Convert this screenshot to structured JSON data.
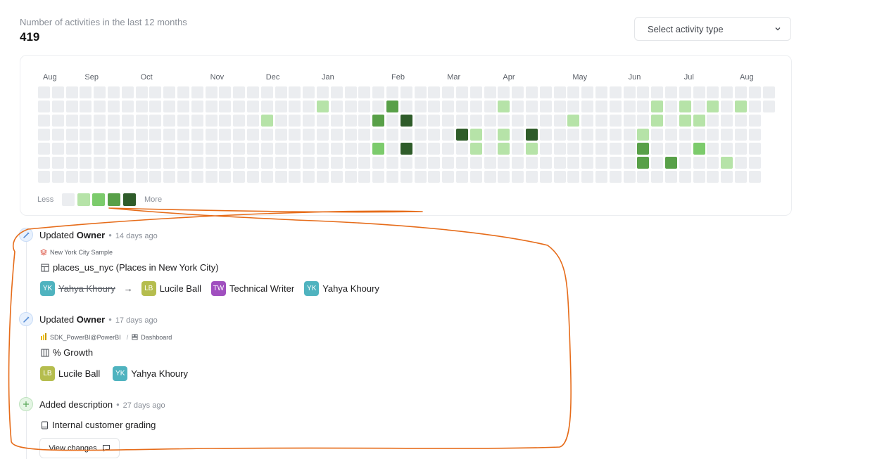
{
  "summary": {
    "label": "Number of activities in the last 12 months",
    "count": "419"
  },
  "filter": {
    "placeholder": "Select activity type"
  },
  "heatmap": {
    "months": [
      "Aug",
      "Sep",
      "Oct",
      "Nov",
      "Dec",
      "Jan",
      "Feb",
      "Mar",
      "Apr",
      "May",
      "Jun",
      "Jul",
      "Aug"
    ],
    "month_week_index": [
      0,
      3,
      7,
      12,
      16,
      20,
      25,
      29,
      33,
      38,
      42,
      46,
      50
    ],
    "weeks": 53,
    "days": 7,
    "last_week_days": 2,
    "levels": {
      "1": "#b6e3a8",
      "2": "#7ccb6c",
      "3": "#58a048",
      "4": "#2f5c2a",
      "0": "#ebedf0"
    },
    "active_cells": [
      {
        "w": 20,
        "d": 1,
        "l": 1
      },
      {
        "w": 25,
        "d": 1,
        "l": 3
      },
      {
        "w": 33,
        "d": 1,
        "l": 1
      },
      {
        "w": 44,
        "d": 1,
        "l": 1
      },
      {
        "w": 46,
        "d": 1,
        "l": 1
      },
      {
        "w": 48,
        "d": 1,
        "l": 1
      },
      {
        "w": 50,
        "d": 1,
        "l": 1
      },
      {
        "w": 16,
        "d": 2,
        "l": 1
      },
      {
        "w": 24,
        "d": 2,
        "l": 3
      },
      {
        "w": 26,
        "d": 2,
        "l": 4
      },
      {
        "w": 38,
        "d": 2,
        "l": 1
      },
      {
        "w": 44,
        "d": 2,
        "l": 1
      },
      {
        "w": 46,
        "d": 2,
        "l": 1
      },
      {
        "w": 47,
        "d": 2,
        "l": 1
      },
      {
        "w": 30,
        "d": 3,
        "l": 4
      },
      {
        "w": 31,
        "d": 3,
        "l": 1
      },
      {
        "w": 33,
        "d": 3,
        "l": 1
      },
      {
        "w": 35,
        "d": 3,
        "l": 4
      },
      {
        "w": 43,
        "d": 3,
        "l": 1
      },
      {
        "w": 24,
        "d": 4,
        "l": 2
      },
      {
        "w": 26,
        "d": 4,
        "l": 4
      },
      {
        "w": 31,
        "d": 4,
        "l": 1
      },
      {
        "w": 33,
        "d": 4,
        "l": 1
      },
      {
        "w": 35,
        "d": 4,
        "l": 1
      },
      {
        "w": 43,
        "d": 4,
        "l": 3
      },
      {
        "w": 47,
        "d": 4,
        "l": 2
      },
      {
        "w": 43,
        "d": 5,
        "l": 3
      },
      {
        "w": 45,
        "d": 5,
        "l": 3
      },
      {
        "w": 49,
        "d": 5,
        "l": 1
      }
    ],
    "legend_less": "Less",
    "legend_more": "More"
  },
  "events": [
    {
      "action": "Updated",
      "field": "Owner",
      "time": "14 days ago",
      "source": "New York City Sample",
      "asset": "places_us_nyc (Places in New York City)",
      "removed": [
        {
          "initials": "YK",
          "name": "Yahya Khoury",
          "color": "#4fb3bf"
        }
      ],
      "owners": [
        {
          "initials": "LB",
          "name": "Lucile Ball",
          "color": "#b5bd4e"
        },
        {
          "initials": "TW",
          "name": "Technical Writer",
          "color": "#a04fbf"
        },
        {
          "initials": "YK",
          "name": "Yahya Khoury",
          "color": "#4fb3bf"
        }
      ]
    },
    {
      "action": "Updated",
      "field": "Owner",
      "time": "17 days ago",
      "source": "SDK_PowerBI@PowerBI",
      "crumb_sep": "/",
      "crumb_type": "Dashboard",
      "asset": "% Growth",
      "owners": [
        {
          "initials": "LB",
          "name": "Lucile Ball",
          "color": "#b5bd4e"
        },
        {
          "initials": "YK",
          "name": "Yahya Khoury",
          "color": "#4fb3bf"
        }
      ]
    },
    {
      "action": "Added description",
      "time": "27 days ago",
      "asset": "Internal customer grading",
      "button": "View changes"
    }
  ]
}
